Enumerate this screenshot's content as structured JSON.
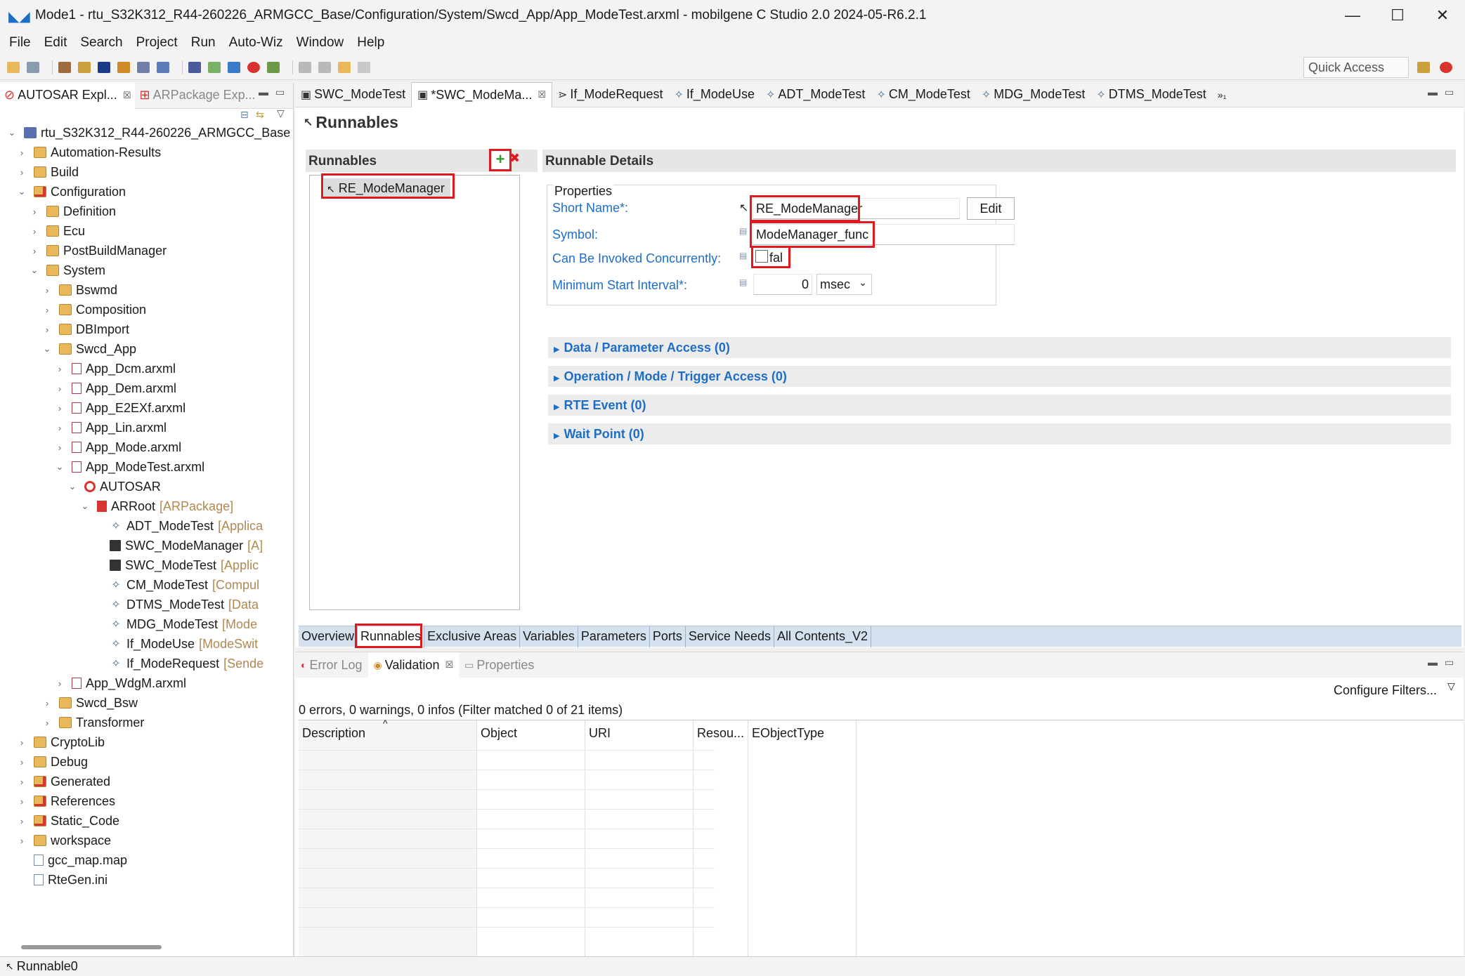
{
  "window": {
    "title": "Mode1 - rtu_S32K312_R44-260226_ARMGCC_Base/Configuration/System/Swcd_App/App_ModeTest.arxml - mobilgene C Studio 2.0 2024-05-R6.2.1",
    "minimize": "—",
    "maximize": "☐",
    "close": "✕"
  },
  "menu": [
    "File",
    "Edit",
    "Search",
    "Project",
    "Run",
    "Auto-Wiz",
    "Window",
    "Help"
  ],
  "quick_access": "Quick Access",
  "left_tabs": [
    {
      "label": "AUTOSAR Expl...",
      "close": "☒"
    },
    {
      "label": "ARPackage Exp..."
    }
  ],
  "tree": {
    "project": "rtu_S32K312_R44-260226_ARMGCC_Base",
    "items": [
      {
        "label": "Automation-Results",
        "level": 1,
        "twisty": "›"
      },
      {
        "label": "Build",
        "level": 1,
        "twisty": "›"
      },
      {
        "label": "Configuration",
        "level": 1,
        "twisty": "⌄"
      },
      {
        "label": "Definition",
        "level": 2,
        "twisty": "›"
      },
      {
        "label": "Ecu",
        "level": 2,
        "twisty": "›"
      },
      {
        "label": "PostBuildManager",
        "level": 2,
        "twisty": "›"
      },
      {
        "label": "System",
        "level": 2,
        "twisty": "⌄"
      },
      {
        "label": "Bswmd",
        "level": 3,
        "twisty": "›"
      },
      {
        "label": "Composition",
        "level": 3,
        "twisty": "›"
      },
      {
        "label": "DBImport",
        "level": 3,
        "twisty": "›"
      },
      {
        "label": "Swcd_App",
        "level": 3,
        "twisty": "⌄"
      },
      {
        "label": "App_Dcm.arxml",
        "level": 4,
        "twisty": "›"
      },
      {
        "label": "App_Dem.arxml",
        "level": 4,
        "twisty": "›"
      },
      {
        "label": "App_E2EXf.arxml",
        "level": 4,
        "twisty": "›"
      },
      {
        "label": "App_Lin.arxml",
        "level": 4,
        "twisty": "›"
      },
      {
        "label": "App_Mode.arxml",
        "level": 4,
        "twisty": "›"
      },
      {
        "label": "App_ModeTest.arxml",
        "level": 4,
        "twisty": "⌄"
      },
      {
        "label": "AUTOSAR",
        "level": 5,
        "twisty": "⌄"
      },
      {
        "label": "ARRoot",
        "tag": "[ARPackage]",
        "level": 6,
        "twisty": "⌄"
      },
      {
        "label": "ADT_ModeTest",
        "tag": "[Applica",
        "level": 7,
        "twisty": ""
      },
      {
        "label": "SWC_ModeManager",
        "tag": "[A]",
        "level": 7,
        "twisty": ""
      },
      {
        "label": "SWC_ModeTest",
        "tag": "[Applic",
        "level": 7,
        "twisty": ""
      },
      {
        "label": "CM_ModeTest",
        "tag": "[Compul",
        "level": 7,
        "twisty": ""
      },
      {
        "label": "DTMS_ModeTest",
        "tag": "[Data",
        "level": 7,
        "twisty": ""
      },
      {
        "label": "MDG_ModeTest",
        "tag": "[Mode",
        "level": 7,
        "twisty": ""
      },
      {
        "label": "If_ModeUse",
        "tag": "[ModeSwit",
        "level": 7,
        "twisty": ""
      },
      {
        "label": "If_ModeRequest",
        "tag": "[Sende",
        "level": 7,
        "twisty": ""
      },
      {
        "label": "App_WdgM.arxml",
        "level": 4,
        "twisty": "›"
      },
      {
        "label": "Swcd_Bsw",
        "level": 3,
        "twisty": "›"
      },
      {
        "label": "Transformer",
        "level": 3,
        "twisty": "›"
      },
      {
        "label": "CryptoLib",
        "level": 1,
        "twisty": "›"
      },
      {
        "label": "Debug",
        "level": 1,
        "twisty": "›"
      },
      {
        "label": "Generated",
        "level": 1,
        "twisty": "›"
      },
      {
        "label": "References",
        "level": 1,
        "twisty": "›"
      },
      {
        "label": "Static_Code",
        "level": 1,
        "twisty": "›"
      },
      {
        "label": "workspace",
        "level": 1,
        "twisty": "›"
      },
      {
        "label": "gcc_map.map",
        "level": 1,
        "twisty": ""
      },
      {
        "label": "RteGen.ini",
        "level": 1,
        "twisty": ""
      }
    ]
  },
  "editor_tabs": [
    {
      "label": "SWC_ModeTest"
    },
    {
      "label": "*SWC_ModeMa...",
      "close": "☒"
    },
    {
      "label": "If_ModeRequest"
    },
    {
      "label": "If_ModeUse"
    },
    {
      "label": "ADT_ModeTest"
    },
    {
      "label": "CM_ModeTest"
    },
    {
      "label": "MDG_ModeTest"
    },
    {
      "label": "DTMS_ModeTest"
    }
  ],
  "editor_overflow": "»₁",
  "editor": {
    "title": "Runnables",
    "runnables_header": "Runnables",
    "add_icon": "+",
    "remove_icon": "✖",
    "runnables": [
      "RE_ModeManager"
    ],
    "details_header": "Runnable Details",
    "properties_label": "Properties",
    "short_name_label": "Short Name*:",
    "short_name_value": "RE_ModeManager",
    "edit_button": "Edit",
    "symbol_label": "Symbol:",
    "symbol_value": "ModeManager_func",
    "concurrent_label": "Can Be Invoked Concurrently:",
    "concurrent_value": "fal",
    "min_interval_label": "Minimum Start Interval*:",
    "min_interval_value": "0",
    "min_interval_unit": "msec",
    "sections": [
      "Data / Parameter Access (0)",
      "Operation / Mode / Trigger Access (0)",
      "RTE Event (0)",
      "Wait Point (0)"
    ]
  },
  "page_tabs": [
    "Overview",
    "Runnables",
    "Exclusive Areas",
    "Variables",
    "Parameters",
    "Ports",
    "Service Needs",
    "All Contents_V2"
  ],
  "bottom_tabs": [
    {
      "label": "Error Log"
    },
    {
      "label": "Validation",
      "close": "☒"
    },
    {
      "label": "Properties"
    }
  ],
  "validation": {
    "summary": "0 errors, 0 warnings, 0 infos (Filter matched 0 of 21 items)",
    "configure_filters": "Configure Filters...",
    "columns": [
      "Description",
      "Object",
      "URI",
      "Resou...",
      "EObjectType"
    ]
  },
  "status": "Runnable0"
}
